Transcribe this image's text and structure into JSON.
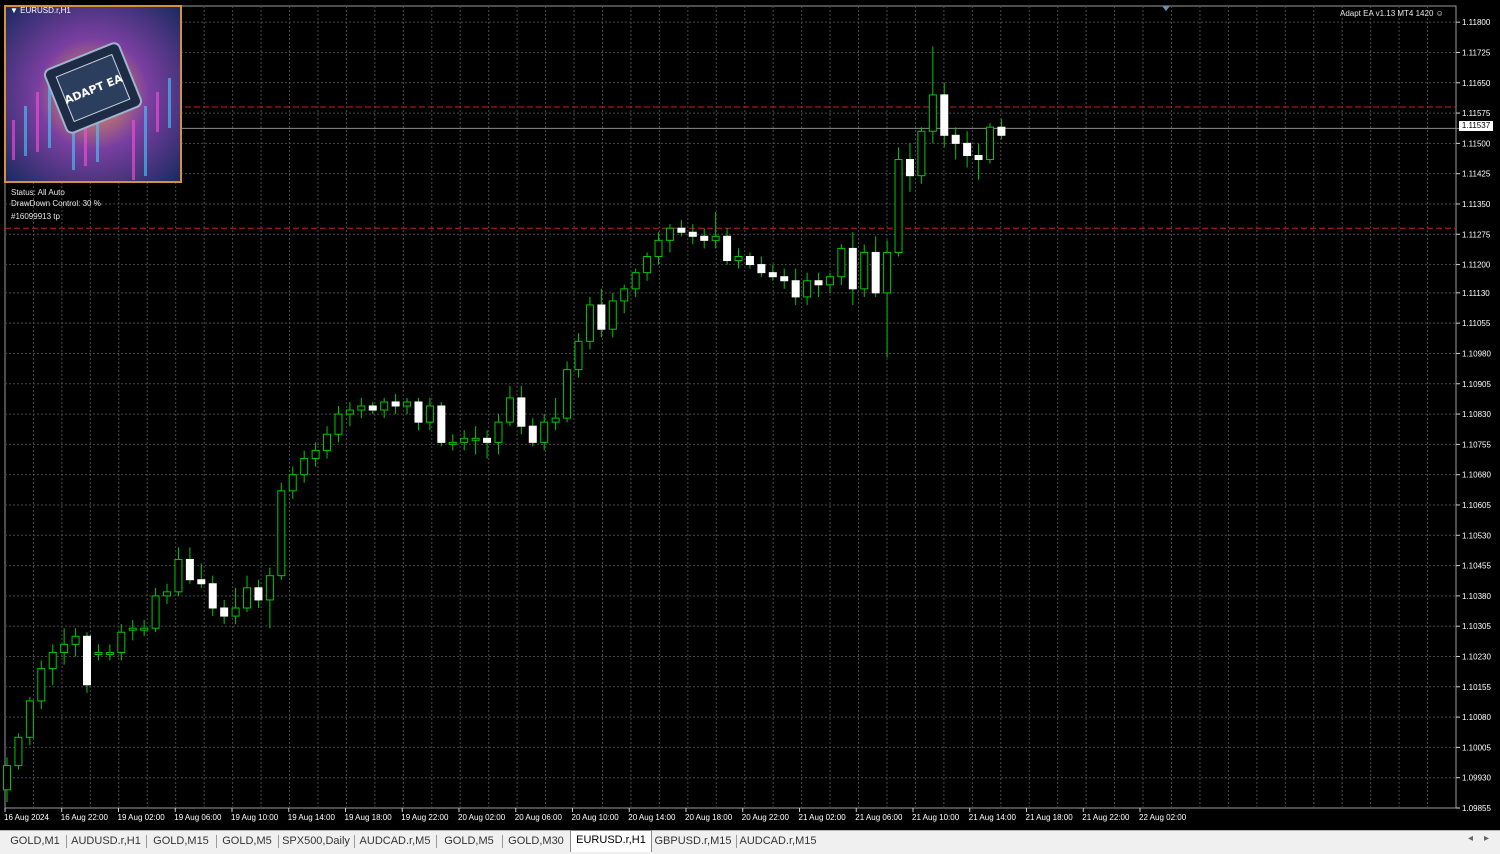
{
  "window": {
    "symbol_title": "EURUSD.r,H1",
    "ea_label": "Adapt EA  v1.13 MT4 1420",
    "logo_text": "ADAPT EA",
    "current_price": "1.11537"
  },
  "info_panel": {
    "status": "Status: All Auto",
    "drawdown": "DrawDown Control: 30 %",
    "order_label": "#16099913 tp"
  },
  "price_axis": [
    "1.11800",
    "1.11725",
    "1.11650",
    "1.11575",
    "1.11500",
    "1.11425",
    "1.11350",
    "1.11275",
    "1.11200",
    "1.11130",
    "1.11055",
    "1.10980",
    "1.10905",
    "1.10830",
    "1.10755",
    "1.10680",
    "1.10605",
    "1.10530",
    "1.10455",
    "1.10380",
    "1.10305",
    "1.10230",
    "1.10155",
    "1.10080",
    "1.10005",
    "1.09930",
    "1.09855"
  ],
  "time_axis": [
    "16 Aug 2024",
    "16 Aug 22:00",
    "19 Aug 02:00",
    "19 Aug 06:00",
    "19 Aug 10:00",
    "19 Aug 14:00",
    "19 Aug 18:00",
    "19 Aug 22:00",
    "20 Aug 02:00",
    "20 Aug 06:00",
    "20 Aug 10:00",
    "20 Aug 14:00",
    "20 Aug 18:00",
    "20 Aug 22:00",
    "21 Aug 02:00",
    "21 Aug 06:00",
    "21 Aug 10:00",
    "21 Aug 14:00",
    "21 Aug 18:00",
    "21 Aug 22:00",
    "22 Aug 02:00"
  ],
  "tabs": [
    {
      "label": "GOLD,M1"
    },
    {
      "label": "AUDUSD.r,H1"
    },
    {
      "label": "GOLD,M15"
    },
    {
      "label": "GOLD,M5"
    },
    {
      "label": "SPX500,Daily"
    },
    {
      "label": "AUDCAD.r,M5"
    },
    {
      "label": "GOLD,M5"
    },
    {
      "label": "GOLD,M30"
    },
    {
      "label": "EURUSD.r,H1"
    },
    {
      "label": "GBPUSD.r,M15"
    },
    {
      "label": "AUDCAD.r,M15"
    }
  ],
  "active_tab_index": 8,
  "colors": {
    "background": "#000000",
    "grid": "#4a4a4a",
    "bull": "#00c800",
    "bear": "#ffffff",
    "level_line": "#c81e1e",
    "bid_line": "#8c8c8c"
  },
  "chart_data": {
    "type": "candlestick",
    "symbol": "EURUSD.r",
    "timeframe": "H1",
    "ylim": [
      1.09855,
      1.1184
    ],
    "levels": [
      1.1159,
      1.1129
    ],
    "bid": 1.11537,
    "candles": [
      [
        1.099,
        1.0998,
        1.0987,
        1.0996
      ],
      [
        1.0996,
        1.1004,
        1.0995,
        1.1003
      ],
      [
        1.1003,
        1.1013,
        1.1001,
        1.1012
      ],
      [
        1.1012,
        1.1022,
        1.101,
        1.102
      ],
      [
        1.102,
        1.1026,
        1.1016,
        1.1024
      ],
      [
        1.1024,
        1.103,
        1.1021,
        1.1026
      ],
      [
        1.1026,
        1.103,
        1.1023,
        1.1028
      ],
      [
        1.1028,
        1.1029,
        1.1014,
        1.1016
      ],
      [
        1.1024,
        1.1026,
        1.1022,
        1.1024
      ],
      [
        1.1024,
        1.1026,
        1.1022,
        1.1024
      ],
      [
        1.1024,
        1.1031,
        1.1022,
        1.1029
      ],
      [
        1.103,
        1.1032,
        1.1027,
        1.103
      ],
      [
        1.103,
        1.1032,
        1.1028,
        1.103
      ],
      [
        1.103,
        1.104,
        1.1029,
        1.1038
      ],
      [
        1.1038,
        1.1041,
        1.1036,
        1.1039
      ],
      [
        1.1039,
        1.105,
        1.1038,
        1.1047
      ],
      [
        1.1047,
        1.105,
        1.1041,
        1.1042
      ],
      [
        1.1042,
        1.1046,
        1.104,
        1.1041
      ],
      [
        1.1041,
        1.1043,
        1.1033,
        1.1035
      ],
      [
        1.1035,
        1.1037,
        1.1031,
        1.1033
      ],
      [
        1.1033,
        1.104,
        1.1031,
        1.1035
      ],
      [
        1.1035,
        1.1043,
        1.1034,
        1.104
      ],
      [
        1.104,
        1.1042,
        1.1035,
        1.1037
      ],
      [
        1.1037,
        1.1045,
        1.103,
        1.1043
      ],
      [
        1.1043,
        1.1066,
        1.1042,
        1.1064
      ],
      [
        1.1064,
        1.107,
        1.1062,
        1.1068
      ],
      [
        1.1068,
        1.1074,
        1.1066,
        1.1072
      ],
      [
        1.1072,
        1.1076,
        1.107,
        1.1074
      ],
      [
        1.1074,
        1.108,
        1.1072,
        1.1078
      ],
      [
        1.1078,
        1.1085,
        1.1076,
        1.1083
      ],
      [
        1.1083,
        1.1086,
        1.108,
        1.1084
      ],
      [
        1.1084,
        1.1087,
        1.1082,
        1.1085
      ],
      [
        1.1085,
        1.1086,
        1.1083,
        1.1084
      ],
      [
        1.1084,
        1.1087,
        1.1082,
        1.1086
      ],
      [
        1.1086,
        1.1088,
        1.1083,
        1.1085
      ],
      [
        1.1085,
        1.1087,
        1.1083,
        1.1086
      ],
      [
        1.1086,
        1.1087,
        1.1079,
        1.1081
      ],
      [
        1.1081,
        1.1087,
        1.1079,
        1.1085
      ],
      [
        1.1085,
        1.1086,
        1.1075,
        1.1076
      ],
      [
        1.1076,
        1.1078,
        1.1074,
        1.1076
      ],
      [
        1.1076,
        1.1079,
        1.1074,
        1.1077
      ],
      [
        1.1077,
        1.108,
        1.1073,
        1.1077
      ],
      [
        1.1077,
        1.1079,
        1.1072,
        1.1076
      ],
      [
        1.1076,
        1.1083,
        1.1073,
        1.1081
      ],
      [
        1.1081,
        1.109,
        1.108,
        1.1087
      ],
      [
        1.1087,
        1.109,
        1.1078,
        1.108
      ],
      [
        1.108,
        1.1082,
        1.1075,
        1.1076
      ],
      [
        1.1076,
        1.1083,
        1.1074,
        1.1081
      ],
      [
        1.1081,
        1.1087,
        1.1079,
        1.1082
      ],
      [
        1.1082,
        1.1096,
        1.1081,
        1.1094
      ],
      [
        1.1094,
        1.1103,
        1.1092,
        1.1101
      ],
      [
        1.1101,
        1.1112,
        1.1099,
        1.111
      ],
      [
        1.111,
        1.1114,
        1.1102,
        1.1104
      ],
      [
        1.1104,
        1.1113,
        1.1102,
        1.1111
      ],
      [
        1.1111,
        1.1115,
        1.1108,
        1.1114
      ],
      [
        1.1114,
        1.1119,
        1.1112,
        1.1118
      ],
      [
        1.1118,
        1.1123,
        1.1116,
        1.1122
      ],
      [
        1.1122,
        1.1128,
        1.112,
        1.1126
      ],
      [
        1.1126,
        1.113,
        1.1123,
        1.1129
      ],
      [
        1.1129,
        1.1131,
        1.1127,
        1.1128
      ],
      [
        1.1128,
        1.113,
        1.1125,
        1.1127
      ],
      [
        1.1127,
        1.1129,
        1.1124,
        1.1126
      ],
      [
        1.1126,
        1.1133,
        1.1124,
        1.1127
      ],
      [
        1.1127,
        1.1129,
        1.112,
        1.1121
      ],
      [
        1.1121,
        1.1124,
        1.1119,
        1.1122
      ],
      [
        1.1122,
        1.1123,
        1.1119,
        1.112
      ],
      [
        1.112,
        1.1122,
        1.1117,
        1.1118
      ],
      [
        1.1118,
        1.112,
        1.1116,
        1.1117
      ],
      [
        1.1117,
        1.1119,
        1.1114,
        1.1116
      ],
      [
        1.1116,
        1.1119,
        1.111,
        1.1112
      ],
      [
        1.1112,
        1.1118,
        1.111,
        1.1116
      ],
      [
        1.1116,
        1.1118,
        1.1112,
        1.1115
      ],
      [
        1.1115,
        1.1118,
        1.1113,
        1.1117
      ],
      [
        1.1117,
        1.1125,
        1.1115,
        1.1124
      ],
      [
        1.1124,
        1.1128,
        1.111,
        1.1114
      ],
      [
        1.1114,
        1.1125,
        1.1112,
        1.1123
      ],
      [
        1.1123,
        1.1127,
        1.1112,
        1.1113
      ],
      [
        1.1113,
        1.1126,
        1.1097,
        1.1123
      ],
      [
        1.1123,
        1.1149,
        1.1122,
        1.1146
      ],
      [
        1.1146,
        1.115,
        1.1138,
        1.1142
      ],
      [
        1.1142,
        1.1154,
        1.114,
        1.1153
      ],
      [
        1.1153,
        1.1174,
        1.115,
        1.1162
      ],
      [
        1.1162,
        1.1165,
        1.1149,
        1.1152
      ],
      [
        1.1152,
        1.1154,
        1.1146,
        1.115
      ],
      [
        1.115,
        1.1153,
        1.1144,
        1.1147
      ],
      [
        1.1147,
        1.115,
        1.1141,
        1.1146
      ],
      [
        1.1146,
        1.1155,
        1.1145,
        1.1154
      ],
      [
        1.1154,
        1.1156,
        1.1151,
        1.1152
      ]
    ]
  }
}
